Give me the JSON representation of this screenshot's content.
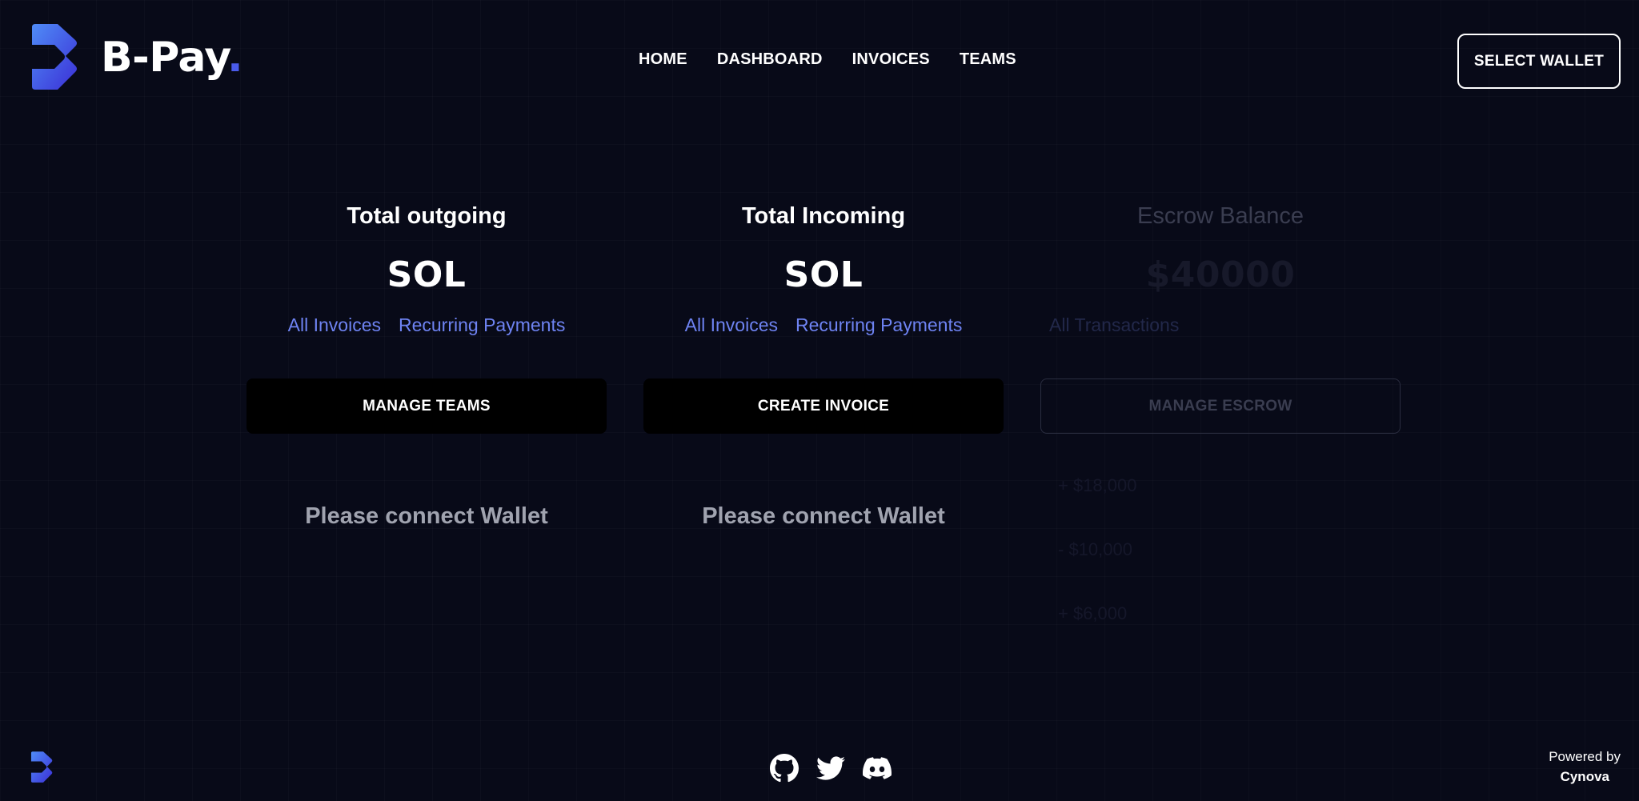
{
  "header": {
    "brand": "B-Pay",
    "brand_dot": ".",
    "logo_icon": "b-pay-arrow-logo",
    "nav": [
      "HOME",
      "DASHBOARD",
      "INVOICES",
      "TEAMS"
    ],
    "wallet_button": "SELECT WALLET"
  },
  "cards": [
    {
      "title": "Total outgoing",
      "amount": "SOL",
      "links": [
        "All Invoices",
        "Recurring Payments"
      ],
      "action": "MANAGE TEAMS",
      "message": "Please connect Wallet"
    },
    {
      "title": "Total Incoming",
      "amount": "SOL",
      "links": [
        "All Invoices",
        "Recurring Payments"
      ],
      "action": "CREATE INVOICE",
      "message": "Please connect Wallet"
    },
    {
      "title": "Escrow Balance",
      "amount": "$40000",
      "links": [
        "All Transactions"
      ],
      "action": "MANAGE ESCROW",
      "transactions": [
        "+ $18,000",
        "- $10,000",
        "+ $6,000"
      ]
    }
  ],
  "footer": {
    "socials": [
      "github-icon",
      "twitter-icon",
      "discord-icon"
    ],
    "powered_by": "Powered by",
    "powered_name": "Cynova"
  },
  "colors": {
    "background": "#080a18",
    "link": "#6e83f2",
    "brand_accent": "#4a5bea"
  }
}
